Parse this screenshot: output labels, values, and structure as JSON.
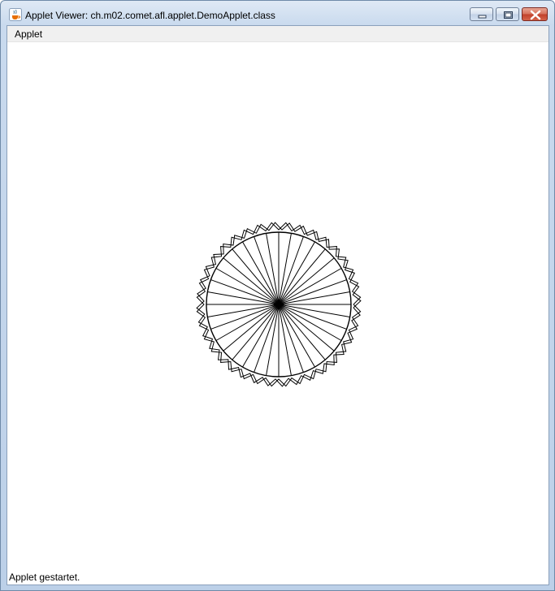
{
  "window": {
    "title": "Applet Viewer: ch.m02.comet.afl.applet.DemoApplet.class",
    "icon": "java-coffee-icon"
  },
  "controls": {
    "minimize_icon": "minimize-icon",
    "maximize_icon": "maximize-icon",
    "close_icon": "close-icon"
  },
  "menubar": {
    "items": [
      {
        "label": "Applet"
      }
    ]
  },
  "applet": {
    "drawing": "spoke-circle-figure",
    "spokes": 36
  },
  "status": {
    "text": "Applet gestartet."
  }
}
